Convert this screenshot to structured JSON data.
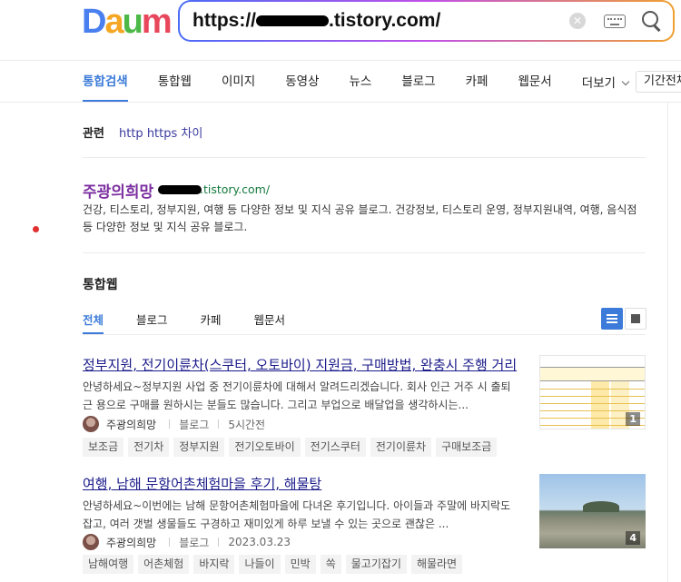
{
  "logo": {
    "letters": [
      "D",
      "a",
      "u",
      "m"
    ],
    "colors": [
      "#4a7ff0",
      "#f5a623",
      "#4cb848",
      "#e8465b"
    ]
  },
  "search": {
    "prefix": "https://",
    "suffix": ".tistory.com/",
    "clear_icon": "close-circle-icon",
    "keyboard_icon": "keyboard-icon",
    "search_icon": "search-icon"
  },
  "tabs": [
    {
      "label": "통합검색",
      "active": true
    },
    {
      "label": "통합웹"
    },
    {
      "label": "이미지"
    },
    {
      "label": "동영상"
    },
    {
      "label": "뉴스"
    },
    {
      "label": "블로그"
    },
    {
      "label": "카페"
    },
    {
      "label": "웹문서"
    }
  ],
  "more_label": "더보기",
  "period_label": "기간전체",
  "related": {
    "label": "관련",
    "query": "http https 차이"
  },
  "site": {
    "title": "주광의희망",
    "url": ".tistory.com/",
    "desc": "건강, 티스토리, 정부지원, 여행 등 다양한 정보 및 지식 공유 블로그. 건강정보, 티스토리 운영, 정부지원내역, 여행, 음식점 등 다양한 정보 및 지식 공유 블로그."
  },
  "section": {
    "title": "통합웹",
    "subtabs": [
      "전체",
      "블로그",
      "카페",
      "웹문서"
    ],
    "view_list_icon": "list-view-icon",
    "view_grid_icon": "grid-view-icon"
  },
  "results": [
    {
      "title": "정부지원, 전기이륜차(스쿠터, 오토바이) 지원금, 구매방법, 완충시 주행 거리",
      "desc": "안녕하세요~정부지원 사업 중 전기이륜차에 대해서 알려드리겠습니다. 회사 인근 거주 시 출퇴근 용으로 구매를 원하시는 분들도 많습니다. 그리고 부업으로 배달업을 생각하시는...",
      "author": "주광의희망",
      "type": "블로그",
      "time": "5시간전",
      "tags": [
        "보조금",
        "전기차",
        "정부지원",
        "전기오토바이",
        "전기스쿠터",
        "전기이륜차",
        "구매보조금"
      ],
      "thumb_count": "1"
    },
    {
      "title": "여행, 남해 문항어촌체험마을 후기, 해물탕",
      "desc": "안녕하세요~이번에는 남해 문항어촌체험마을에 다녀온 후기입니다. 아이들과 주말에 바지락도 잡고, 여러 갯벌 생물들도 구경하고 재미있게 하루 보낼 수 있는 곳으로 괜찮은 ...",
      "author": "주광의희망",
      "type": "블로그",
      "time": "2023.03.23",
      "tags": [
        "남해여행",
        "어촌체험",
        "바지락",
        "나들이",
        "민박",
        "쏙",
        "물고기잡기",
        "해물라면"
      ],
      "thumb_count": "4"
    }
  ]
}
